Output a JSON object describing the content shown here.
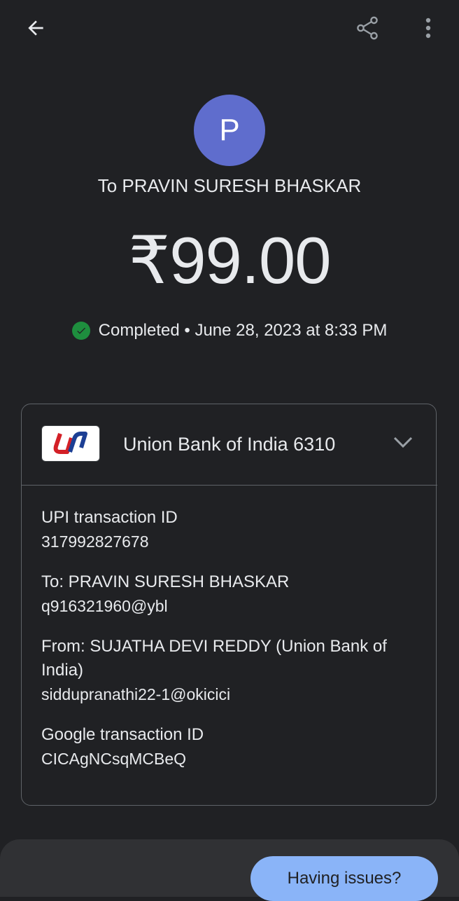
{
  "header": {
    "back_icon": "arrow-left-icon",
    "share_icon": "share-icon",
    "more_icon": "more-vert-icon"
  },
  "payee": {
    "avatar_initial": "P",
    "avatar_color": "#5f6dcd",
    "to_text": "To PRAVIN SURESH BHASKAR"
  },
  "amount": "₹99.00",
  "status": {
    "icon": "check-circle-icon",
    "color": "#1e8e3e",
    "text": "Completed • June 28, 2023 at 8:33 PM"
  },
  "bank": {
    "name": "Union Bank of India 6310",
    "logo_icon": "union-bank-logo",
    "expand_icon": "chevron-down-icon"
  },
  "details": {
    "upi_label": "UPI transaction ID",
    "upi_value": "317992827678",
    "to_label": "To: PRAVIN SURESH BHASKAR",
    "to_value": "q916321960@ybl",
    "from_label": "From: SUJATHA  DEVI REDDY (Union Bank of India)",
    "from_value": "siddupranathi22-1@okicici",
    "google_label": "Google transaction ID",
    "google_value": "CICAgNCsqMCBeQ"
  },
  "footer": {
    "issues_button": "Having issues?",
    "accent": "#8ab4f8"
  }
}
